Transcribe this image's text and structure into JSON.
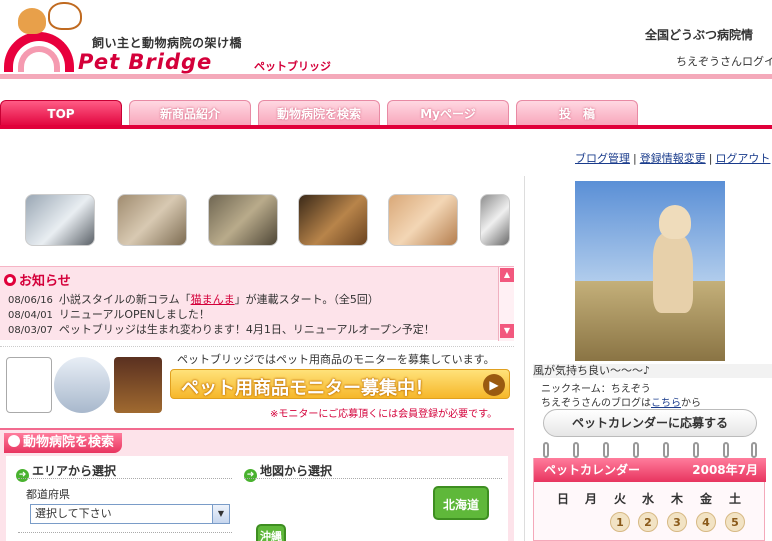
{
  "header": {
    "tagline": "飼い主と動物病院の架け橋",
    "brand": "Pet Bridge",
    "brand_kana": "ペットブリッジ",
    "right_title": "全国どうぶつ病院情",
    "login_text": "ちえぞうさんログイ"
  },
  "nav": {
    "tabs": [
      {
        "label": "TOP",
        "active": true
      },
      {
        "label": "新商品紹介",
        "active": false
      },
      {
        "label": "動物病院を検索",
        "active": false
      },
      {
        "label": "Myページ",
        "active": false
      },
      {
        "label": "投　稿",
        "active": false
      }
    ]
  },
  "toplinks": {
    "blog": "ブログ管理",
    "profile": "登録情報変更",
    "logout": "ログアウト"
  },
  "thumbs": [
    "cat-thumb",
    "rabbit-thumb",
    "tabby-thumb",
    "dog-thumb",
    "sleeping-cats-thumb",
    "partial-thumb"
  ],
  "notice": {
    "title": "お知らせ",
    "items": [
      {
        "date": "08/06/16",
        "pre": "小説スタイルの新コラム「",
        "link": "猫まんま",
        "post": "」が連載スタート。（全5回）"
      },
      {
        "date": "08/04/01",
        "pre": "リニューアルOPENしました！",
        "link": "",
        "post": ""
      },
      {
        "date": "08/03/07",
        "pre": "ペットブリッジは生まれ変わります！4月1日、リニューアルオープン予定！",
        "link": "",
        "post": ""
      }
    ]
  },
  "monitor": {
    "text": "ペットブリッジではペット用商品のモニターを募集しています。",
    "banner": "ペット用商品モニター募集中！",
    "note": "※モニターにご応募頂くには会員登録が必要です。"
  },
  "hospital": {
    "title": "動物病院を検索",
    "area_head": "エリアから選択",
    "map_head": "地図から選択",
    "pref_label": "都道府県",
    "pref_select": "選択して下さい",
    "map_hokkaido": "北海道",
    "map_okinawa": "沖縄"
  },
  "sidebar": {
    "caption": "風が気持ち良い～～～♪",
    "nickname": "ニックネーム：ちえぞう",
    "blog_pre": "ちえぞうさんのブログは",
    "blog_link": "こちら",
    "blog_post": "から",
    "apply_button": "ペットカレンダーに応募する",
    "calendar_title": "ペットカレンダー",
    "calendar_month": "2008年7月",
    "weekdays": [
      "日",
      "月",
      "火",
      "水",
      "木",
      "金",
      "土"
    ],
    "days": [
      "1",
      "2",
      "3",
      "4",
      "5"
    ]
  },
  "colors": {
    "accent": "#e0003a",
    "pink_light": "#fde3ea",
    "link": "#1a3c8c",
    "green": "#49b22f"
  }
}
